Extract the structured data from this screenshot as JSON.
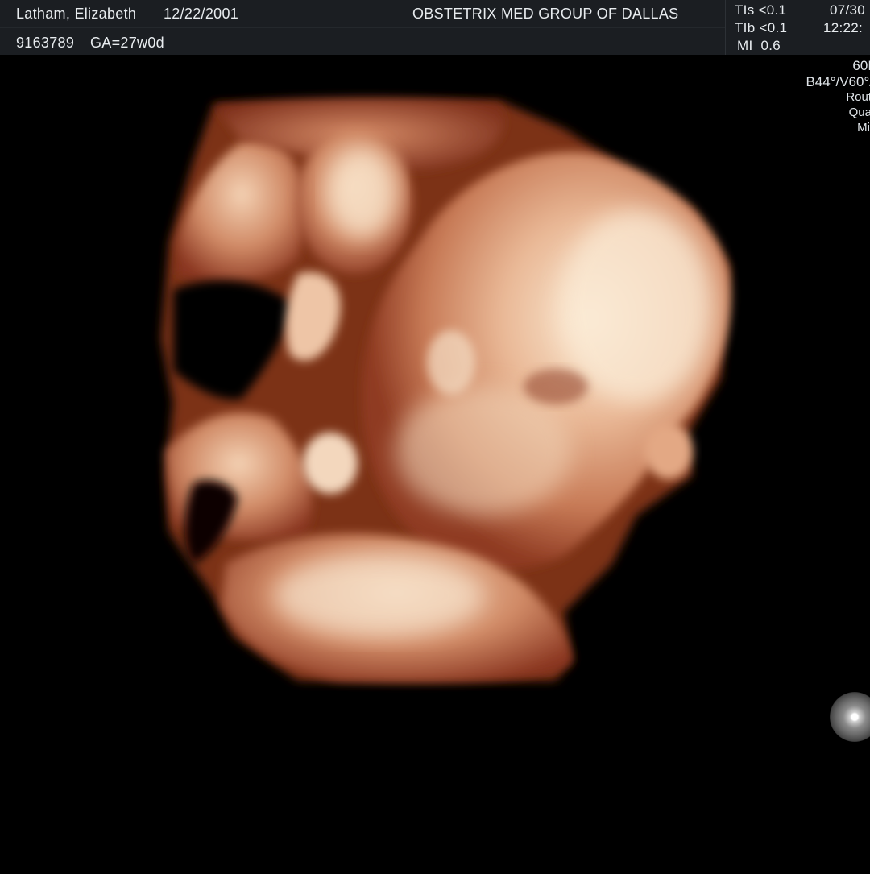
{
  "header": {
    "patient_name": "Latham, Elizabeth",
    "patient_dob": "12/22/2001",
    "patient_id": "9163789",
    "gestational_age": "GA=27w0d",
    "institution": "OBSTETRIX MED GROUP OF DALLAS",
    "tis": "TIs <0.1",
    "tib": "TIb <0.1",
    "mi": "MI  0.6",
    "date": "07/30",
    "time": "12:22:"
  },
  "side_panel": {
    "line1": "60I",
    "line2": "B44°/V60°/",
    "line3": "Rout",
    "line4": "Qua",
    "line5": "Mi"
  },
  "colors": {
    "header_bg": "#1b1e22",
    "background": "#000000",
    "tissue_dark": "#8a3a22",
    "tissue_mid": "#c97a58",
    "tissue_light": "#f3dcc0"
  },
  "image_content": {
    "render_mode": "3D surface-rendered obstetric ultrasound",
    "palette": "sepia"
  },
  "icons": {
    "orientation_marker": "orientation-ball-icon"
  }
}
